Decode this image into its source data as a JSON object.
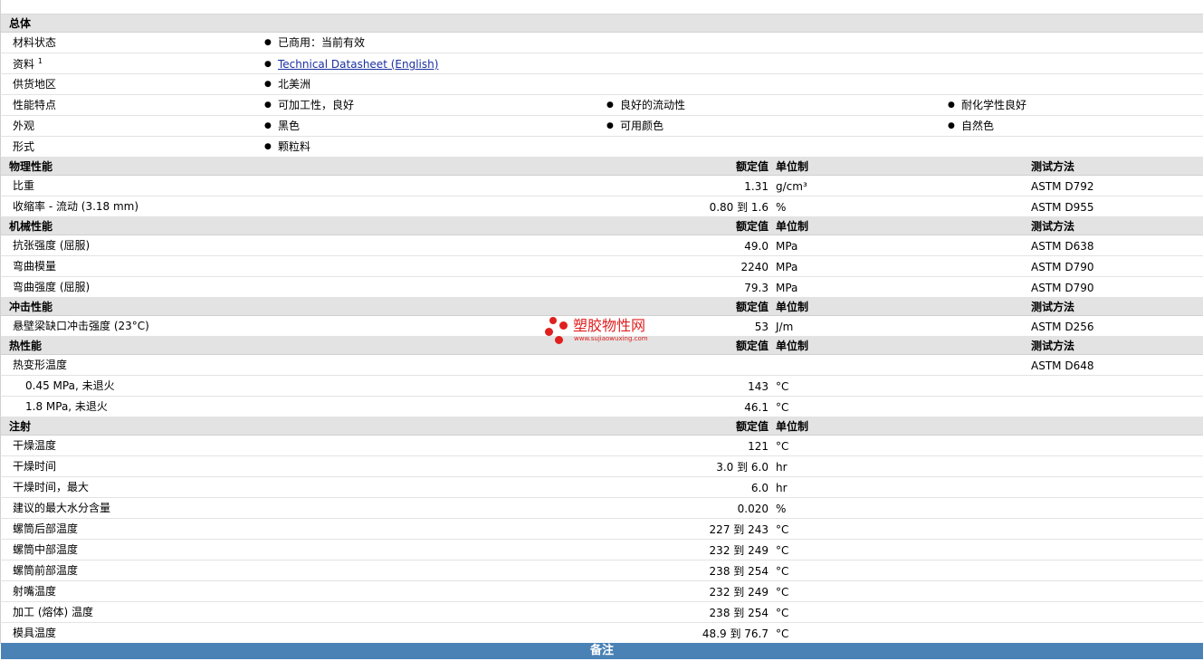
{
  "general": {
    "title": "总体",
    "rows": [
      {
        "label": "材料状态",
        "items": [
          "已商用：当前有效"
        ]
      },
      {
        "label": "资料",
        "sup": "1",
        "link": "Technical Datasheet (English)"
      },
      {
        "label": "供货地区",
        "items": [
          "北美洲"
        ]
      },
      {
        "label": "性能特点",
        "items": [
          "可加工性，良好",
          "良好的流动性",
          "耐化学性良好"
        ]
      },
      {
        "label": "外观",
        "items": [
          "黑色",
          "可用颜色",
          "自然色"
        ]
      },
      {
        "label": "形式",
        "items": [
          "颗粒料"
        ]
      }
    ]
  },
  "headers": {
    "nominal": "额定值",
    "unit": "单位制",
    "test": "测试方法"
  },
  "physical": {
    "title": "物理性能",
    "rows": [
      {
        "label": "比重",
        "value": "1.31",
        "unit": "g/cm³",
        "test": "ASTM D792"
      },
      {
        "label": "收缩率 - 流动 (3.18 mm)",
        "value": "0.80 到 1.6",
        "unit": "%",
        "test": "ASTM D955"
      }
    ]
  },
  "mechanical": {
    "title": "机械性能",
    "rows": [
      {
        "label": "抗张强度 (屈服)",
        "value": "49.0",
        "unit": "MPa",
        "test": "ASTM D638"
      },
      {
        "label": "弯曲模量",
        "value": "2240",
        "unit": "MPa",
        "test": "ASTM D790"
      },
      {
        "label": "弯曲强度 (屈服)",
        "value": "79.3",
        "unit": "MPa",
        "test": "ASTM D790"
      }
    ]
  },
  "impact": {
    "title": "冲击性能",
    "rows": [
      {
        "label": "悬壁梁缺口冲击强度 (23°C)",
        "value": "53",
        "unit": "J/m",
        "test": "ASTM D256"
      }
    ]
  },
  "thermal": {
    "title": "热性能",
    "rows": [
      {
        "label": "热变形温度",
        "value": "",
        "unit": "",
        "test": "ASTM D648"
      },
      {
        "label": "0.45 MPa, 未退火",
        "value": "143",
        "unit": "°C",
        "test": "",
        "sub": true
      },
      {
        "label": "1.8 MPa, 未退火",
        "value": "46.1",
        "unit": "°C",
        "test": "",
        "sub": true
      }
    ]
  },
  "injection": {
    "title": "注射",
    "rows": [
      {
        "label": "干燥温度",
        "value": "121",
        "unit": "°C"
      },
      {
        "label": "干燥时间",
        "value": "3.0 到 6.0",
        "unit": "hr"
      },
      {
        "label": "干燥时间，最大",
        "value": "6.0",
        "unit": "hr"
      },
      {
        "label": "建议的最大水分含量",
        "value": "0.020",
        "unit": "%"
      },
      {
        "label": "螺筒后部温度",
        "value": "227 到 243",
        "unit": "°C"
      },
      {
        "label": "螺筒中部温度",
        "value": "232 到 249",
        "unit": "°C"
      },
      {
        "label": "螺筒前部温度",
        "value": "238 到 254",
        "unit": "°C"
      },
      {
        "label": "射嘴温度",
        "value": "232 到 249",
        "unit": "°C"
      },
      {
        "label": "加工 (熔体) 温度",
        "value": "238 到 254",
        "unit": "°C"
      },
      {
        "label": "模具温度",
        "value": "48.9 到 76.7",
        "unit": "°C"
      }
    ]
  },
  "notes": {
    "title": "备注"
  },
  "watermark": {
    "name": "塑胶物性网",
    "url": "www.sujiaowuxing.com"
  },
  "colors": {
    "section_bg": "#e3e3e3",
    "notes_bar": "#4a82b6",
    "watermark": "#e02020",
    "link": "#1a2fa0"
  }
}
